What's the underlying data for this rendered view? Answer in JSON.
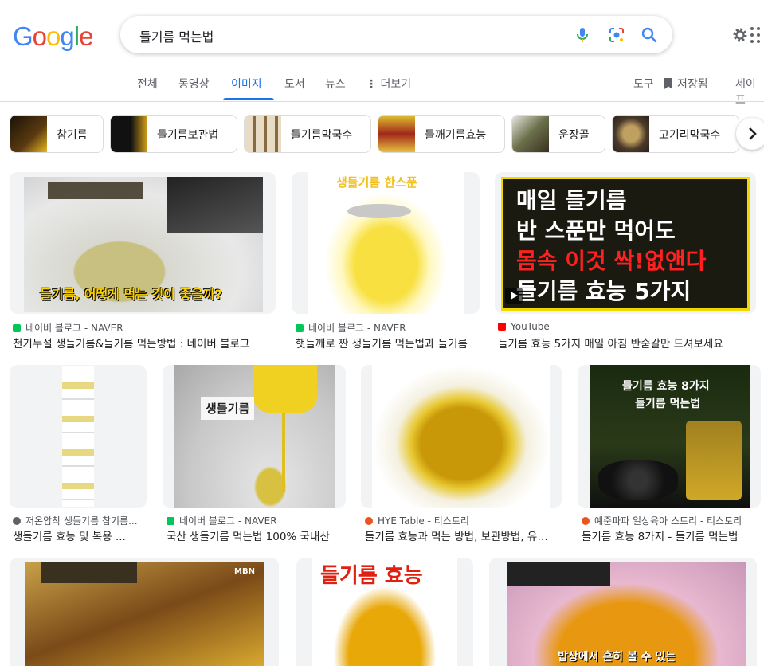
{
  "header": {
    "logo_letters": [
      "G",
      "o",
      "o",
      "g",
      "l",
      "e"
    ],
    "query": "들기름 먹는법",
    "icons": [
      "mic-icon",
      "lens-icon",
      "search-icon",
      "settings-gear-icon"
    ]
  },
  "tabs": [
    {
      "label": "전체"
    },
    {
      "label": "동영상"
    },
    {
      "label": "이미지"
    },
    {
      "label": "도서"
    },
    {
      "label": "뉴스"
    },
    {
      "label": "더보기"
    }
  ],
  "tools": {
    "label": "도구",
    "saved": "저장됨",
    "safe": "세이프"
  },
  "chips": [
    {
      "label": "참기름",
      "color": "#3a2a10"
    },
    {
      "label": "들기름보관법",
      "color": "#1f1a12"
    },
    {
      "label": "들기름막국수",
      "color": "#d9c7a5"
    },
    {
      "label": "들깨기름효능",
      "color": "#c9a62a"
    },
    {
      "label": "운장골",
      "color": "#8a8f6a"
    },
    {
      "label": "고기리막국수",
      "color": "#5a4a3a"
    }
  ],
  "results": [
    {
      "source": "네이버 블로그 - NAVER",
      "title": "천기누설 생들기름&들기름 먹는방법 : 네이버 블로그",
      "fav": "#03c75a",
      "overlay": "들기름, 어떻게 먹는 것이 좋을까?"
    },
    {
      "source": "네이버 블로그 - NAVER",
      "title": "햇들깨로 짠 생들기름 먹는법과 들기름",
      "fav": "#03c75a",
      "overlay": "생들기름 한스푼"
    },
    {
      "source": "YouTube",
      "title": "들기름 효능 5가지 매일 아침 반숟갈만 드셔보세요",
      "fav": "#ff0000",
      "overlay_lines": [
        "매일 들기름",
        "반 스푼만 먹어도",
        "몸속 이것 싹!없앤다",
        "들기름 효능 5가지"
      ]
    },
    {
      "source": "저온압착 생들기름 참기름...",
      "title": "생들기름 효능 및 복용 ...",
      "fav": "#5f6368"
    },
    {
      "source": "네이버 블로그 - NAVER",
      "title": "국산 생들기름 먹는법 100% 국내산",
      "fav": "#03c75a",
      "overlay": "생들기름"
    },
    {
      "source": "HYE Table - 티스토리",
      "title": "들기름 효능과 먹는 방법, 보관방법, 유통기한",
      "fav": "#eb531f"
    },
    {
      "source": "예준파파 일상육아 스토리 - 티스토리",
      "title": "들기름 효능 8가지 - 들기름 먹는법",
      "fav": "#eb531f",
      "overlay_lines": [
        "들기름 효능 8가지",
        "들기름 먹는법"
      ]
    },
    {
      "overlay": "MBN"
    },
    {
      "overlay": "들기름 효능"
    },
    {
      "overlay": "밥상에서 흔히 볼 수 있는"
    }
  ]
}
